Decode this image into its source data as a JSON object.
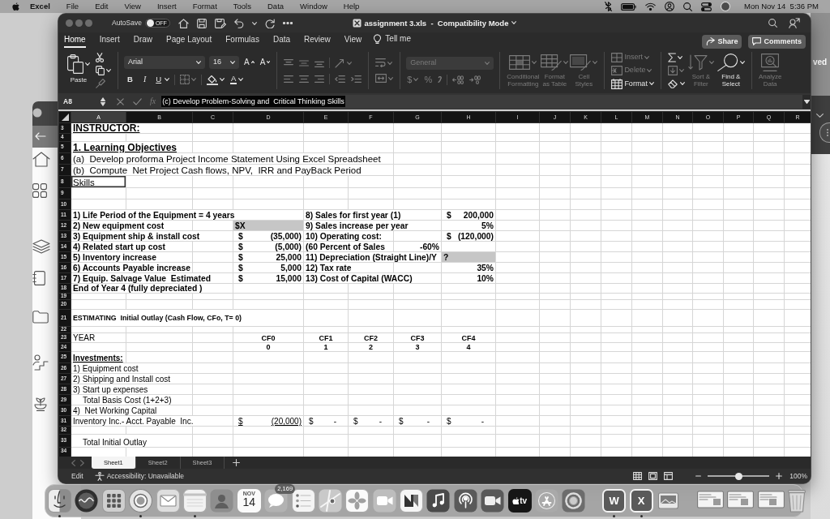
{
  "menu_bar": {
    "app": "Excel",
    "items": [
      "File",
      "Edit",
      "View",
      "Insert",
      "Format",
      "Tools",
      "Data",
      "Window",
      "Help"
    ],
    "clock": "Mon Nov 14  5:36 PM"
  },
  "background": {
    "edge_text": "ved"
  },
  "title_bar": {
    "autosave_label": "AutoSave",
    "autosave": {
      "on": false,
      "label": "OFF"
    },
    "title": "assignment 3.xls  -  Compatibility Mode"
  },
  "ribbon_tabs": [
    {
      "label": "Home",
      "selected": true
    },
    {
      "label": "Insert",
      "selected": false
    },
    {
      "label": "Draw",
      "selected": false
    },
    {
      "label": "Page Layout",
      "selected": false
    },
    {
      "label": "Formulas",
      "selected": false
    },
    {
      "label": "Data",
      "selected": false
    },
    {
      "label": "Review",
      "selected": false
    },
    {
      "label": "View",
      "selected": false
    }
  ],
  "tell_me": "Tell me",
  "share": "Share",
  "comments": "Comments",
  "ribbon": [
    {
      "kind": "clipboard",
      "commands": [
        {
          "kind": "paste",
          "label": "Paste",
          "disabled": false
        },
        {
          "kind": "cut",
          "disabled": false
        },
        {
          "kind": "copy",
          "disabled": false
        },
        {
          "kind": "painter",
          "disabled": true
        }
      ]
    },
    {
      "kind": "font",
      "commands": [
        {
          "kind": "font-name",
          "value": "Arial",
          "disabled": false
        },
        {
          "kind": "font-size",
          "value": "16",
          "disabled": false
        },
        {
          "kind": "grow",
          "label": "A",
          "disabled": false
        },
        {
          "kind": "shrink",
          "label": "A",
          "disabled": false
        },
        {
          "kind": "bold",
          "label": "B",
          "disabled": false
        },
        {
          "kind": "italic",
          "label": "I",
          "disabled": false
        },
        {
          "kind": "underline",
          "label": "U",
          "disabled": false
        },
        {
          "kind": "borders",
          "disabled": true
        },
        {
          "kind": "fill",
          "disabled": false
        },
        {
          "kind": "font-color",
          "label": "A",
          "disabled": false
        }
      ]
    },
    {
      "kind": "alignment",
      "commands": [
        {
          "kind": "top",
          "disabled": true
        },
        {
          "kind": "middle",
          "disabled": true
        },
        {
          "kind": "bottom",
          "disabled": true
        },
        {
          "kind": "orientation",
          "disabled": true
        },
        {
          "kind": "left",
          "disabled": true
        },
        {
          "kind": "center",
          "disabled": true
        },
        {
          "kind": "right",
          "disabled": true
        },
        {
          "kind": "outdent",
          "disabled": true
        },
        {
          "kind": "indent",
          "disabled": true
        }
      ]
    },
    {
      "kind": "wrap",
      "commands": [
        {
          "kind": "wrap",
          "disabled": true
        },
        {
          "kind": "merge",
          "disabled": true
        }
      ]
    },
    {
      "kind": "number",
      "commands": [
        {
          "kind": "number-format",
          "value": "General",
          "disabled": true
        },
        {
          "kind": "currency",
          "label": "$",
          "disabled": true
        },
        {
          "kind": "percent",
          "label": "%",
          "disabled": true
        },
        {
          "kind": "comma",
          "disabled": true
        },
        {
          "kind": "more-decimals",
          "disabled": true
        },
        {
          "kind": "fewer-decimals",
          "disabled": true
        }
      ]
    },
    {
      "kind": "styles",
      "commands": [
        {
          "kind": "conditional",
          "label": "Conditional\nFormatting",
          "disabled": true
        },
        {
          "kind": "table",
          "label": "Format\nas Table",
          "disabled": true
        },
        {
          "kind": "cell-styles",
          "label": "Cell\nStyles",
          "disabled": true
        }
      ]
    },
    {
      "kind": "cells",
      "commands": [
        {
          "kind": "insert",
          "label": "Insert",
          "disabled": true
        },
        {
          "kind": "delete",
          "label": "Delete",
          "disabled": true
        },
        {
          "kind": "format-cells",
          "label": "Format",
          "disabled": false
        }
      ]
    },
    {
      "kind": "editing",
      "commands": [
        {
          "kind": "sum",
          "disabled": false
        },
        {
          "kind": "fill-down",
          "disabled": true
        },
        {
          "kind": "clear",
          "disabled": false
        },
        {
          "kind": "sort",
          "label": "Sort &\nFilter",
          "disabled": true
        },
        {
          "kind": "find",
          "label": "Find &\nSelect",
          "disabled": false
        }
      ]
    },
    {
      "kind": "analysis",
      "commands": [
        {
          "kind": "analyze",
          "label": "Analyze\nData",
          "disabled": true
        }
      ]
    }
  ],
  "formula_bar": {
    "name_box": "A8",
    "fx": "fx",
    "formula": "(c) Develop Problem-Solving and  Critical Thinking Skills"
  },
  "sheet": {
    "columns": [
      {
        "label": "A",
        "selected": true
      },
      {
        "label": "B",
        "selected": false
      },
      {
        "label": "C",
        "selected": false
      },
      {
        "label": "D",
        "selected": false
      },
      {
        "label": "E",
        "selected": false
      },
      {
        "label": "F",
        "selected": false
      },
      {
        "label": "G",
        "selected": false
      },
      {
        "label": "H",
        "selected": false
      },
      {
        "label": "I",
        "selected": false
      },
      {
        "label": "J",
        "selected": false
      },
      {
        "label": "K",
        "selected": false
      },
      {
        "label": "L",
        "selected": false
      },
      {
        "label": "M",
        "selected": false
      },
      {
        "label": "N",
        "selected": false
      },
      {
        "label": "O",
        "selected": false
      },
      {
        "label": "P",
        "selected": false
      },
      {
        "label": "Q",
        "selected": false
      },
      {
        "label": "R",
        "selected": false
      }
    ],
    "rows": [
      {
        "number": "3",
        "cells": {
          "A": {
            "kind": "heading",
            "text": "INSTRUCTOR:",
            "selected": false
          }
        }
      },
      {
        "number": "4"
      },
      {
        "number": "5",
        "cells": {
          "A": {
            "kind": "heading",
            "text": "1. Learning Objectives",
            "selected": false
          }
        }
      },
      {
        "number": "6",
        "cells": {
          "A": {
            "kind": "body",
            "text": "(a)  Develop proforma Project Income Statement Using Excel Spreadsheet",
            "selected": false
          }
        }
      },
      {
        "number": "7",
        "cells": {
          "A": {
            "kind": "body",
            "text": "(b)  Compute  Net Project Cash flows, NPV,  IRR and PayBack Period",
            "selected": false
          }
        }
      },
      {
        "number": "8",
        "cells": {
          "A": {
            "kind": "body",
            "text": "Skills",
            "selected": true
          }
        }
      },
      {
        "number": "9"
      },
      {
        "number": "10"
      },
      {
        "number": "11",
        "cells": {
          "A": {
            "kind": "label",
            "text": "1) Life Period of the Equipment = 4 years",
            "selected": false
          },
          "E": {
            "kind": "label",
            "text": "8) Sales for first year (1)",
            "selected": false
          },
          "H": {
            "kind": "amount",
            "symbol": "$",
            "value": "200,000",
            "selected": false
          }
        }
      },
      {
        "number": "12",
        "cells": {
          "A": {
            "kind": "label",
            "text": "2) New equipment cost",
            "selected": false
          },
          "D": {
            "kind": "input",
            "text": "$X",
            "selected": false
          },
          "E": {
            "kind": "label",
            "text": "9) Sales increase per year",
            "selected": false
          },
          "H": {
            "kind": "figure",
            "text": "5%",
            "selected": false
          }
        }
      },
      {
        "number": "13",
        "cells": {
          "A": {
            "kind": "label",
            "text": "3) Equipment ship & install cost",
            "selected": false
          },
          "D": {
            "kind": "amount",
            "symbol": "$",
            "value": "(35,000)",
            "selected": false
          },
          "E": {
            "kind": "label",
            "text": "10) Operating cost:",
            "selected": false
          },
          "H": {
            "kind": "amount",
            "symbol": "$",
            "value": "(120,000)",
            "selected": false
          }
        }
      },
      {
        "number": "14",
        "cells": {
          "A": {
            "kind": "label",
            "text": "4) Related start up cost",
            "selected": false
          },
          "D": {
            "kind": "amount",
            "symbol": "$",
            "value": "(5,000)",
            "selected": false
          },
          "E": {
            "kind": "label",
            "text": "(60 Percent of Sales",
            "selected": false
          },
          "G": {
            "kind": "figure",
            "text": "-60%",
            "selected": false
          }
        }
      },
      {
        "number": "15",
        "cells": {
          "A": {
            "kind": "label",
            "text": "5) Inventory increase",
            "selected": false
          },
          "D": {
            "kind": "amount",
            "symbol": "$",
            "value": "25,000",
            "selected": false
          },
          "E": {
            "kind": "label",
            "text": "11) Depreciation (Straight Line)/Y",
            "selected": false
          },
          "H": {
            "kind": "input",
            "text": "?",
            "selected": false
          }
        }
      },
      {
        "number": "16",
        "cells": {
          "A": {
            "kind": "label",
            "text": "6) Accounts Payable increase",
            "selected": false
          },
          "D": {
            "kind": "amount",
            "symbol": "$",
            "value": "5,000",
            "selected": false
          },
          "E": {
            "kind": "label",
            "text": "12) Tax rate",
            "selected": false
          },
          "H": {
            "kind": "figure",
            "text": "35%",
            "selected": false
          }
        }
      },
      {
        "number": "17",
        "cells": {
          "A": {
            "kind": "label",
            "text": "7) Equip. Salvage Value  Estimated",
            "selected": false
          },
          "D": {
            "kind": "amount",
            "symbol": "$",
            "value": "15,000",
            "selected": false
          },
          "E": {
            "kind": "label",
            "text": "13) Cost of Capital (WACC)",
            "selected": false
          },
          "H": {
            "kind": "figure",
            "text": "10%",
            "selected": false
          }
        }
      },
      {
        "number": "18",
        "cells": {
          "A": {
            "kind": "label",
            "text": "End of Year 4 (fully depreciated )",
            "selected": false
          }
        }
      },
      {
        "number": "19"
      },
      {
        "number": "20"
      },
      {
        "number": "21",
        "cells": {
          "A": {
            "kind": "caption",
            "text": "ESTIMATING  Initial Outlay (Cash Flow, CFo, T= 0)",
            "selected": false
          }
        }
      },
      {
        "number": "22"
      },
      {
        "number": "23",
        "cells": {
          "A": {
            "kind": "plain",
            "text": "YEAR",
            "selected": false
          },
          "D": {
            "kind": "column",
            "text": "CF0",
            "selected": false
          },
          "E": {
            "kind": "column",
            "text": "CF1",
            "selected": false
          },
          "F": {
            "kind": "column",
            "text": "CF2",
            "selected": false
          },
          "G": {
            "kind": "column",
            "text": "CF3",
            "selected": false
          },
          "H": {
            "kind": "column",
            "text": "CF4",
            "selected": false
          }
        }
      },
      {
        "number": "24",
        "cells": {
          "D": {
            "kind": "column",
            "text": "0",
            "selected": false
          },
          "E": {
            "kind": "column",
            "text": "1",
            "selected": false
          },
          "F": {
            "kind": "column",
            "text": "2",
            "selected": false
          },
          "G": {
            "kind": "column",
            "text": "3",
            "selected": false
          },
          "H": {
            "kind": "column",
            "text": "4",
            "selected": false
          }
        }
      },
      {
        "number": "25",
        "cells": {
          "A": {
            "kind": "subheading",
            "text": "Investments:",
            "selected": false
          }
        }
      },
      {
        "number": "26",
        "cells": {
          "A": {
            "kind": "plain",
            "text": "1) Equipment cost",
            "selected": false
          }
        }
      },
      {
        "number": "27",
        "cells": {
          "A": {
            "kind": "plain",
            "text": "2) Shipping and Install cost",
            "selected": false
          }
        }
      },
      {
        "number": "28",
        "cells": {
          "A": {
            "kind": "plain",
            "text": "3) Start up expenses",
            "selected": false
          }
        }
      },
      {
        "number": "29",
        "cells": {
          "A": {
            "kind": "indent",
            "text": "Total Basis Cost (1+2+3)",
            "selected": false
          }
        }
      },
      {
        "number": "30",
        "cells": {
          "A": {
            "kind": "plain",
            "text": "4)  Net Working Capital",
            "selected": false
          }
        }
      },
      {
        "number": "31",
        "cells": {
          "A": {
            "kind": "plain",
            "text": "Inventory Inc.- Acct. Payable  Inc.",
            "selected": false
          },
          "D": {
            "kind": "total",
            "symbol": "$",
            "value": "(20,000)",
            "selected": false
          },
          "E": {
            "kind": "money",
            "symbol": "$",
            "value": "-",
            "selected": false
          },
          "F": {
            "kind": "money",
            "symbol": "$",
            "value": "-",
            "selected": false
          },
          "G": {
            "kind": "money",
            "symbol": "$",
            "value": "-",
            "selected": false
          },
          "H": {
            "kind": "money",
            "symbol": "$",
            "value": "-",
            "selected": false
          }
        }
      },
      {
        "number": "32"
      },
      {
        "number": "33",
        "cells": {
          "A": {
            "kind": "indent",
            "text": "Total Initial Outlay",
            "selected": false
          }
        }
      },
      {
        "number": "34"
      }
    ]
  },
  "sheet_tabs": [
    {
      "label": "Sheet1",
      "selected": true
    },
    {
      "label": "Sheet2",
      "selected": false
    },
    {
      "label": "Sheet3",
      "selected": false
    }
  ],
  "status_bar": {
    "mode": "Edit",
    "accessibility": "Accessibility: Unavailable",
    "zoom": {
      "level": 0.5,
      "reading": "100%"
    }
  },
  "dock": {
    "apps": [
      {
        "kind": "finder",
        "running": true
      },
      {
        "kind": "assistant",
        "running": false
      },
      {
        "kind": "launcher",
        "running": false
      },
      {
        "kind": "browser",
        "running": true
      },
      {
        "kind": "mail",
        "running": false
      },
      {
        "kind": "notes",
        "running": true
      },
      {
        "kind": "contacts",
        "running": false
      },
      {
        "kind": "calendar",
        "running": false,
        "month": "NOV",
        "day": "14"
      },
      {
        "kind": "messages",
        "running": false,
        "badge": "2,169"
      },
      {
        "kind": "reminders",
        "running": false
      },
      {
        "kind": "maps",
        "running": false
      },
      {
        "kind": "photos",
        "running": false
      },
      {
        "kind": "facetime",
        "running": false
      },
      {
        "kind": "news",
        "running": false
      },
      {
        "kind": "music",
        "running": false
      },
      {
        "kind": "podcasts",
        "running": false
      },
      {
        "kind": "camera",
        "running": false
      },
      {
        "kind": "tv",
        "running": false,
        "label": "tv"
      },
      {
        "kind": "store",
        "running": false
      },
      {
        "kind": "settings",
        "running": false
      }
    ],
    "recent": [
      {
        "kind": "word",
        "label": "W",
        "running": true
      },
      {
        "kind": "excel",
        "label": "X",
        "running": true
      },
      {
        "kind": "preview",
        "running": false
      }
    ]
  }
}
